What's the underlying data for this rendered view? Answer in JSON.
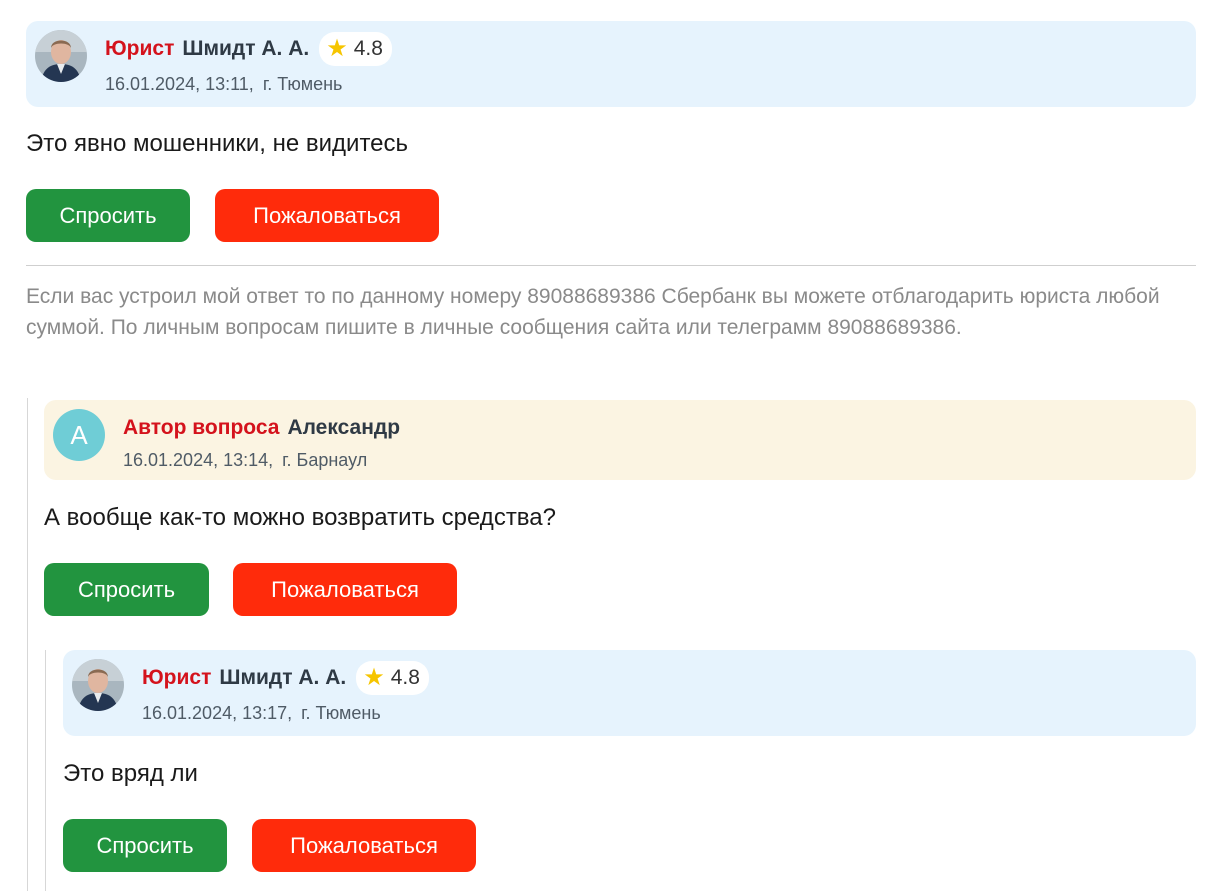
{
  "messages": [
    {
      "role": "Юрист",
      "name": "Шмидт А. А.",
      "rating": "4.8",
      "date": "16.01.2024, 13:11,",
      "city": "г. Тюмень",
      "text": "Это явно мошенники, не видитесь",
      "ask_label": "Спросить",
      "complain_label": "Пожаловаться",
      "signature": "Если вас устроил мой ответ то по данному номеру 89088689386 Сбербанк вы можете отблагодарить юриста любой суммой. По личным вопросам пишите в личные сообщения сайта или телеграмм 89088689386."
    },
    {
      "role": "Автор вопроса",
      "name": "Александр",
      "avatar_letter": "А",
      "date": "16.01.2024, 13:14,",
      "city": "г. Барнаул",
      "text": "А вообще как-то можно возвратить средства?",
      "ask_label": "Спросить",
      "complain_label": "Пожаловаться"
    },
    {
      "role": "Юрист",
      "name": "Шмидт А. А.",
      "rating": "4.8",
      "date": "16.01.2024, 13:17,",
      "city": "г. Тюмень",
      "text": "Это вряд ли",
      "ask_label": "Спросить",
      "complain_label": "Пожаловаться"
    }
  ],
  "colors": {
    "role": "#d4121c",
    "ask_button": "#22943f",
    "complain_button": "#ff2b0b",
    "lawyer_header_bg": "#e6f3fd",
    "author_header_bg": "#fbf4e2",
    "author_avatar": "#6fcdd6",
    "rating_star": "#f6c500"
  },
  "icons": [
    "lawyer-avatar-photo",
    "author-letter-avatar",
    "star-icon"
  ]
}
